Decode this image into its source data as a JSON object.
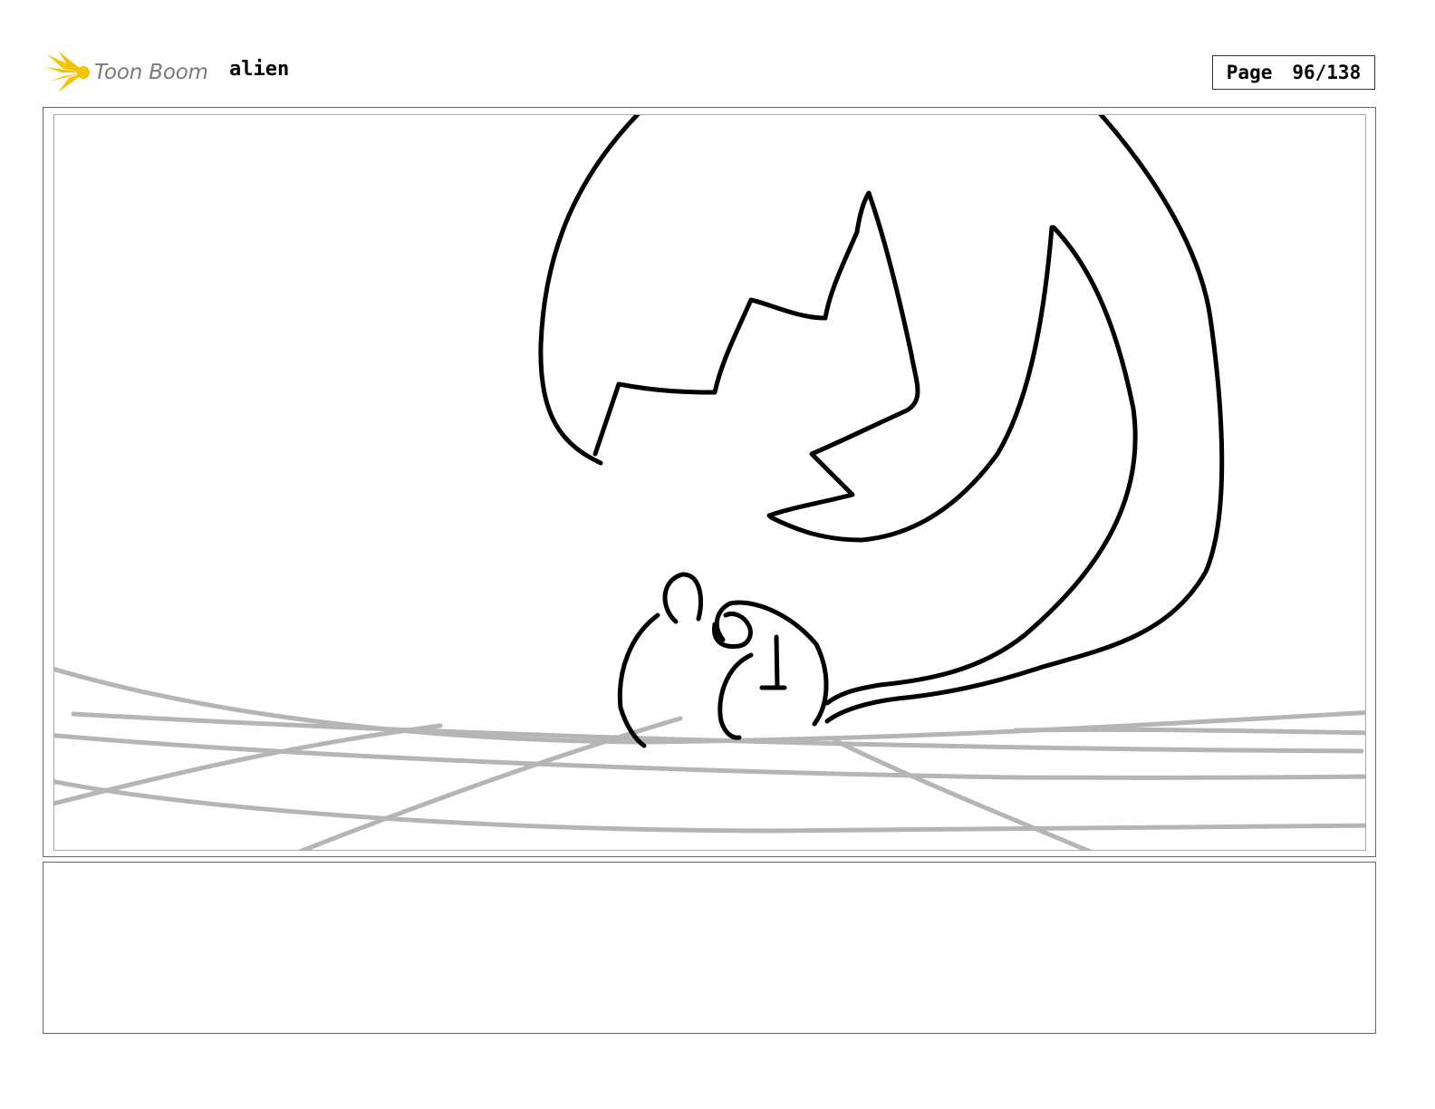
{
  "header": {
    "logo_text": "Toon Boom",
    "project_name": "alien",
    "page_label": "Page",
    "page_number": "96/138"
  },
  "colors": {
    "logo_yellow": "#f5c400",
    "logo_gray": "#7a7a7a",
    "ink": "#000000",
    "ground_lines": "#b5b5b5",
    "frame_border": "#666666"
  },
  "panel": {
    "sketch": "storyboard-drawing"
  },
  "notes": {
    "text": ""
  }
}
